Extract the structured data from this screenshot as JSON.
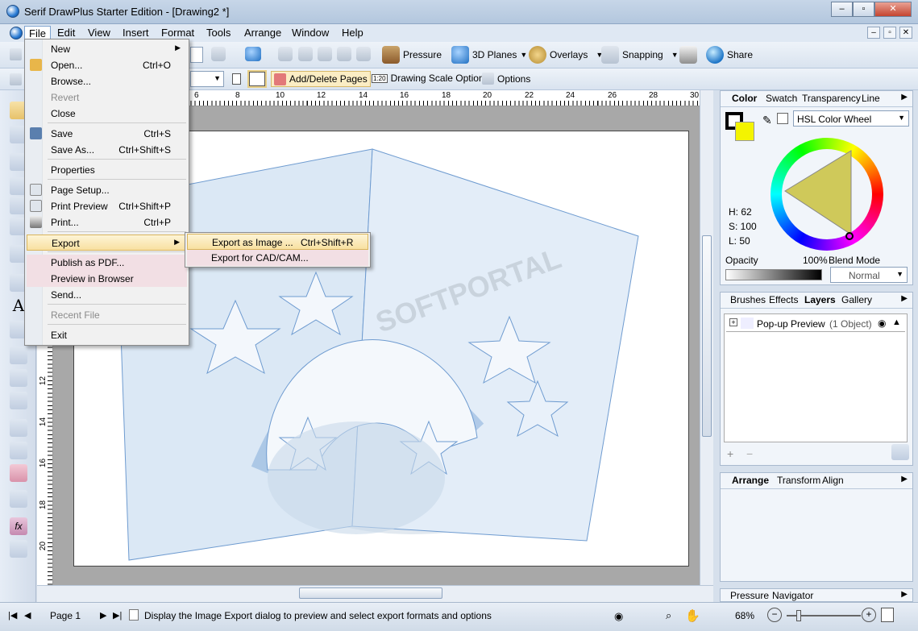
{
  "window": {
    "title": "Serif DrawPlus Starter Edition - [Drawing2 *]"
  },
  "menubar": [
    "File",
    "Edit",
    "View",
    "Insert",
    "Format",
    "Tools",
    "Arrange",
    "Window",
    "Help"
  ],
  "toolbar1": {
    "pressure": "Pressure",
    "planes": "3D Planes",
    "overlays": "Overlays",
    "snapping": "Snapping",
    "share": "Share"
  },
  "toolbar2": {
    "add_delete": "Add/Delete Pages",
    "scale": "Drawing Scale Options",
    "options": "Options",
    "scale_icon": "1:20"
  },
  "ruler": {
    "top": [
      "6",
      "8",
      "10",
      "12",
      "14",
      "16",
      "18",
      "20",
      "22",
      "24",
      "26",
      "28",
      "30"
    ],
    "left": [
      "12",
      "14",
      "16",
      "18",
      "20"
    ]
  },
  "file_menu": [
    {
      "label": "New",
      "shortcut": "",
      "arrow": true
    },
    {
      "label": "Open...",
      "shortcut": "Ctrl+O"
    },
    {
      "label": "Browse...",
      "shortcut": ""
    },
    {
      "label": "Revert",
      "shortcut": "",
      "disabled": true
    },
    {
      "label": "Close",
      "shortcut": ""
    },
    {
      "label": "Save",
      "shortcut": "Ctrl+S"
    },
    {
      "label": "Save As...",
      "shortcut": "Ctrl+Shift+S"
    },
    {
      "label": "Properties",
      "shortcut": ""
    },
    {
      "label": "Page Setup...",
      "shortcut": ""
    },
    {
      "label": "Print Preview",
      "shortcut": "Ctrl+Shift+P"
    },
    {
      "label": "Print...",
      "shortcut": "Ctrl+P"
    },
    {
      "label": "Export",
      "shortcut": "",
      "arrow": true
    },
    {
      "label": "Publish as PDF...",
      "shortcut": ""
    },
    {
      "label": "Preview in Browser",
      "shortcut": ""
    },
    {
      "label": "Send...",
      "shortcut": ""
    },
    {
      "label": "Recent File",
      "shortcut": "",
      "disabled": true
    },
    {
      "label": "Exit",
      "shortcut": ""
    }
  ],
  "export_submenu": [
    {
      "label": "Export as Image ...",
      "shortcut": "Ctrl+Shift+R"
    },
    {
      "label": "Export for CAD/CAM...",
      "shortcut": ""
    }
  ],
  "color_panel": {
    "tabs": [
      "Color",
      "Swatch",
      "Transparency",
      "Line"
    ],
    "mode": "HSL Color Wheel",
    "h": "H: 62",
    "s": "S: 100",
    "l": "L: 50",
    "opacity_label": "Opacity",
    "opacity_value": "100%",
    "blend_label": "Blend Mode",
    "blend_value": "Normal"
  },
  "layers_panel": {
    "tabs": [
      "Brushes",
      "Effects",
      "Layers",
      "Gallery"
    ],
    "layer_name": "Pop-up Preview",
    "layer_count": "(1 Object)"
  },
  "arrange_panel": {
    "tabs": [
      "Arrange",
      "Transform",
      "Align"
    ]
  },
  "bottom_panel": {
    "tabs": [
      "Pressure",
      "Navigator"
    ]
  },
  "status": {
    "page": "Page 1",
    "message": "Display the Image Export dialog to preview and select export formats and options",
    "zoom": "68%"
  }
}
